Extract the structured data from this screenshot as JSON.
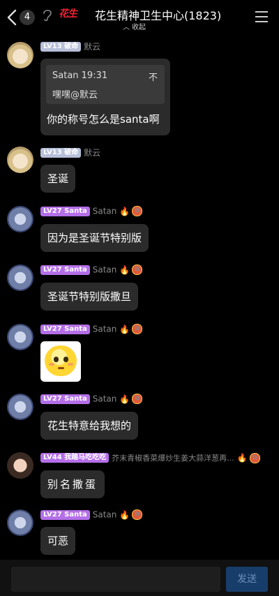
{
  "header": {
    "unread_count": "4",
    "logo_text": "花生",
    "title": "花生精神卫生中心(1823)",
    "collapse_label": "收起"
  },
  "messages": [
    {
      "level": "LV13 破命",
      "name": "默云",
      "quote": {
        "author_time": "Satan 19:31",
        "close": "不",
        "text": "嘿嘿@默云"
      },
      "text": "你的称号怎么是santa啊"
    },
    {
      "level": "LV13 破命",
      "name": "默云",
      "text": "圣诞"
    },
    {
      "level": "LV27 Santa",
      "name": "Satan",
      "text": "因为是圣诞节特别版"
    },
    {
      "level": "LV27 Santa",
      "name": "Satan",
      "text": "圣诞节特别版撒旦"
    },
    {
      "level": "LV27 Santa",
      "name": "Satan",
      "sticker": "smiling-face-sticker"
    },
    {
      "level": "LV27 Santa",
      "name": "Satan",
      "text": "花生特意给我想的"
    },
    {
      "level": "LV44 我踏马吃吃吃",
      "name": "芥末青椒香菜爆炒生姜大蒜洋葱再...",
      "text": "别名撒蛋"
    },
    {
      "level": "LV27 Santa",
      "name": "Satan",
      "text": "可恶"
    }
  ],
  "footer": {
    "input_value": "",
    "send_label": "发送"
  },
  "colors": {
    "background": "#000000",
    "bubble": "#2b2b2b",
    "level_gray": "#b7c0d8",
    "level_purple": "#b46fe8",
    "send_button": "#173d6a",
    "logo_red": "#e23333"
  }
}
